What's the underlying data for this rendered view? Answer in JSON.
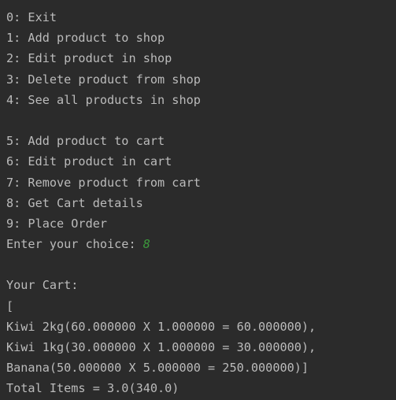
{
  "menu": {
    "items": [
      "0: Exit",
      "1: Add product to shop",
      "2: Edit product in shop",
      "3: Delete product from shop",
      "4: See all products in shop"
    ],
    "cart_items": [
      "5: Add product to cart",
      "6: Edit product in cart",
      "7: Remove product from cart",
      "8: Get Cart details",
      "9: Place Order"
    ]
  },
  "prompt": {
    "label": "Enter your choice: ",
    "value": "8",
    "value_color": "#3c9a3c"
  },
  "output": {
    "header": "Your Cart:",
    "open_bracket": "[",
    "lines": [
      "Kiwi 2kg(60.000000 X 1.000000 = 60.000000),",
      "Kiwi 1kg(30.000000 X 1.000000 = 30.000000),",
      "Banana(50.000000 X 5.000000 = 250.000000)]"
    ],
    "total": "Total Items = 3.0(340.0)"
  },
  "colors": {
    "background": "#2b2b2b",
    "text": "#bbbbbb"
  }
}
